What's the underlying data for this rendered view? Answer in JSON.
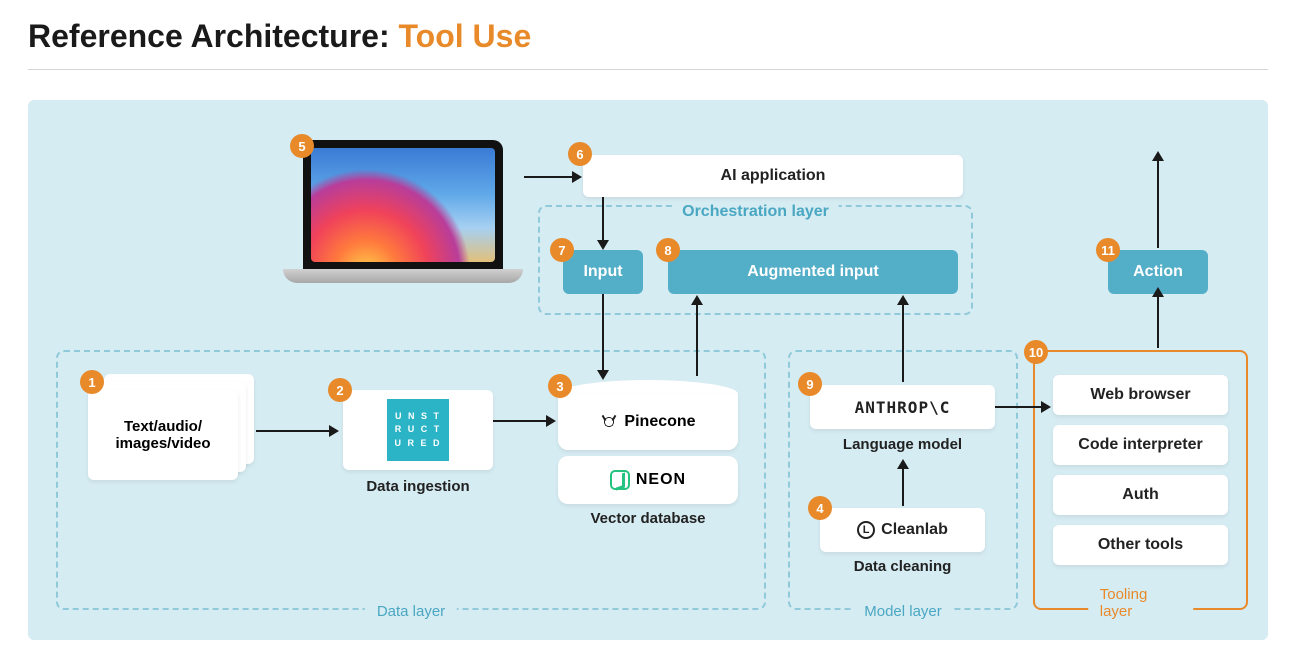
{
  "title": {
    "prefix": "Reference Architecture: ",
    "accent": "Tool Use"
  },
  "badges": {
    "n1": "1",
    "n2": "2",
    "n3": "3",
    "n4": "4",
    "n5": "5",
    "n6": "6",
    "n7": "7",
    "n8": "8",
    "n9": "9",
    "n10": "10",
    "n11": "11"
  },
  "nodes": {
    "ai_application": "AI application",
    "input": "Input",
    "augmented_input": "Augmented input",
    "action": "Action",
    "text_media": "Text/audio/\nimages/video",
    "web_browser": "Web browser",
    "code_interpreter": "Code interpreter",
    "auth": "Auth",
    "other_tools": "Other tools"
  },
  "captions": {
    "data_ingestion": "Data ingestion",
    "vector_database": "Vector database",
    "language_model": "Language model",
    "data_cleaning": "Data cleaning"
  },
  "vendors": {
    "unstructured_l1": "U N S T",
    "unstructured_l2": "R U C T",
    "unstructured_l3": "U R E D",
    "pinecone": "Pinecone",
    "neon": "NEON",
    "anthropic": "ANTHROP\\C",
    "cleanlab": "Cleanlab",
    "cleanlab_mark": "L"
  },
  "layers": {
    "orchestration": "Orchestration layer",
    "data": "Data layer",
    "model": "Model layer",
    "tooling": "Tooling layer"
  }
}
